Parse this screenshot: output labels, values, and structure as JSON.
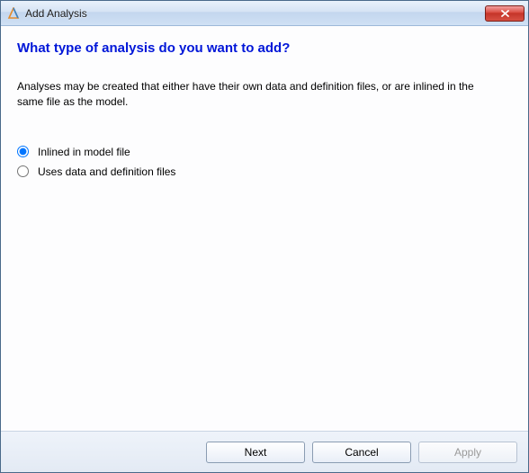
{
  "titlebar": {
    "title": "Add Analysis"
  },
  "content": {
    "heading": "What type of analysis do you want to add?",
    "description": "Analyses may be created that either have their own data and definition files, or are inlined in the same file as the model.",
    "options": {
      "inlined": "Inlined in model file",
      "files": "Uses data and definition files"
    }
  },
  "buttons": {
    "next": "Next",
    "cancel": "Cancel",
    "apply": "Apply"
  }
}
